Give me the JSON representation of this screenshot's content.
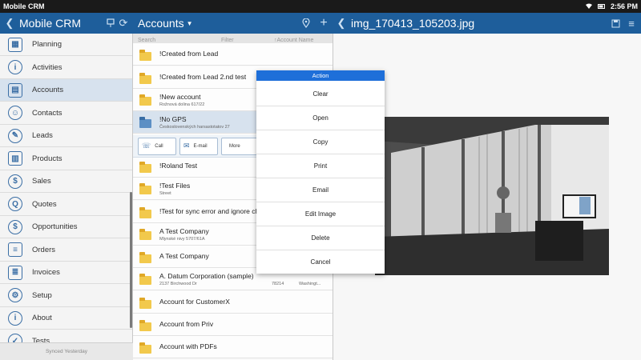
{
  "statusbar": {
    "app_title": "Mobile CRM",
    "time": "2:56 PM"
  },
  "header": {
    "app_name": "Mobile CRM",
    "list_title": "Accounts",
    "viewer_title": "img_170413_105203.jpg"
  },
  "sidebar": {
    "items": [
      {
        "label": "Planning",
        "icon": "planning-icon",
        "glyph": "▦"
      },
      {
        "label": "Activities",
        "icon": "activities-icon",
        "glyph": "i"
      },
      {
        "label": "Accounts",
        "icon": "accounts-icon",
        "glyph": "▤"
      },
      {
        "label": "Contacts",
        "icon": "contacts-icon",
        "glyph": "☺"
      },
      {
        "label": "Leads",
        "icon": "leads-icon",
        "glyph": "✎"
      },
      {
        "label": "Products",
        "icon": "products-icon",
        "glyph": "▥"
      },
      {
        "label": "Sales",
        "icon": "sales-icon",
        "glyph": "$"
      },
      {
        "label": "Quotes",
        "icon": "quotes-icon",
        "glyph": "Q"
      },
      {
        "label": "Opportunities",
        "icon": "opportunities-icon",
        "glyph": "$"
      },
      {
        "label": "Orders",
        "icon": "orders-icon",
        "glyph": "≡"
      },
      {
        "label": "Invoices",
        "icon": "invoices-icon",
        "glyph": "≣"
      },
      {
        "label": "Setup",
        "icon": "setup-icon",
        "glyph": "⚙"
      },
      {
        "label": "About",
        "icon": "about-icon",
        "glyph": "i"
      },
      {
        "label": "Tests",
        "icon": "tests-icon",
        "glyph": "✓"
      }
    ],
    "active_index": 2,
    "footer": "Synced Yesterday"
  },
  "list": {
    "header": {
      "search": "Search",
      "filter": "Filter",
      "sort": "↑Account Name"
    },
    "rows": [
      {
        "title": "!Created from Lead",
        "sub": ""
      },
      {
        "title": "!Created from Lead 2.nd test",
        "sub": ""
      },
      {
        "title": "!New account",
        "sub": "Rožnová dolina 617/22"
      },
      {
        "title": "!No GPS",
        "sub": "Československých harsastotatov 27"
      },
      {
        "title": "!Roland Test",
        "sub": ""
      },
      {
        "title": "!Test Files",
        "sub": "Street"
      },
      {
        "title": "!Test for sync error and ignore ch",
        "sub": ""
      },
      {
        "title": "A Test Company",
        "sub": "Mlynské nivy 5707/61A"
      },
      {
        "title": "A Test Company",
        "sub": ""
      },
      {
        "title": "A. Datum Corporation (sample)",
        "sub": "2137 Birchwood Dr",
        "zip": "78214",
        "city": "Washingt..."
      },
      {
        "title": "Account for CustomerX",
        "sub": ""
      },
      {
        "title": "Account from Priv",
        "sub": ""
      },
      {
        "title": "Account with PDFs",
        "sub": ""
      }
    ],
    "actions": {
      "call": "Call",
      "email": "E-mail",
      "more": "More"
    }
  },
  "dialog": {
    "title": "Action",
    "items": [
      "Clear",
      "Open",
      "Copy",
      "Print",
      "Email",
      "Edit Image",
      "Delete",
      "Cancel"
    ]
  }
}
